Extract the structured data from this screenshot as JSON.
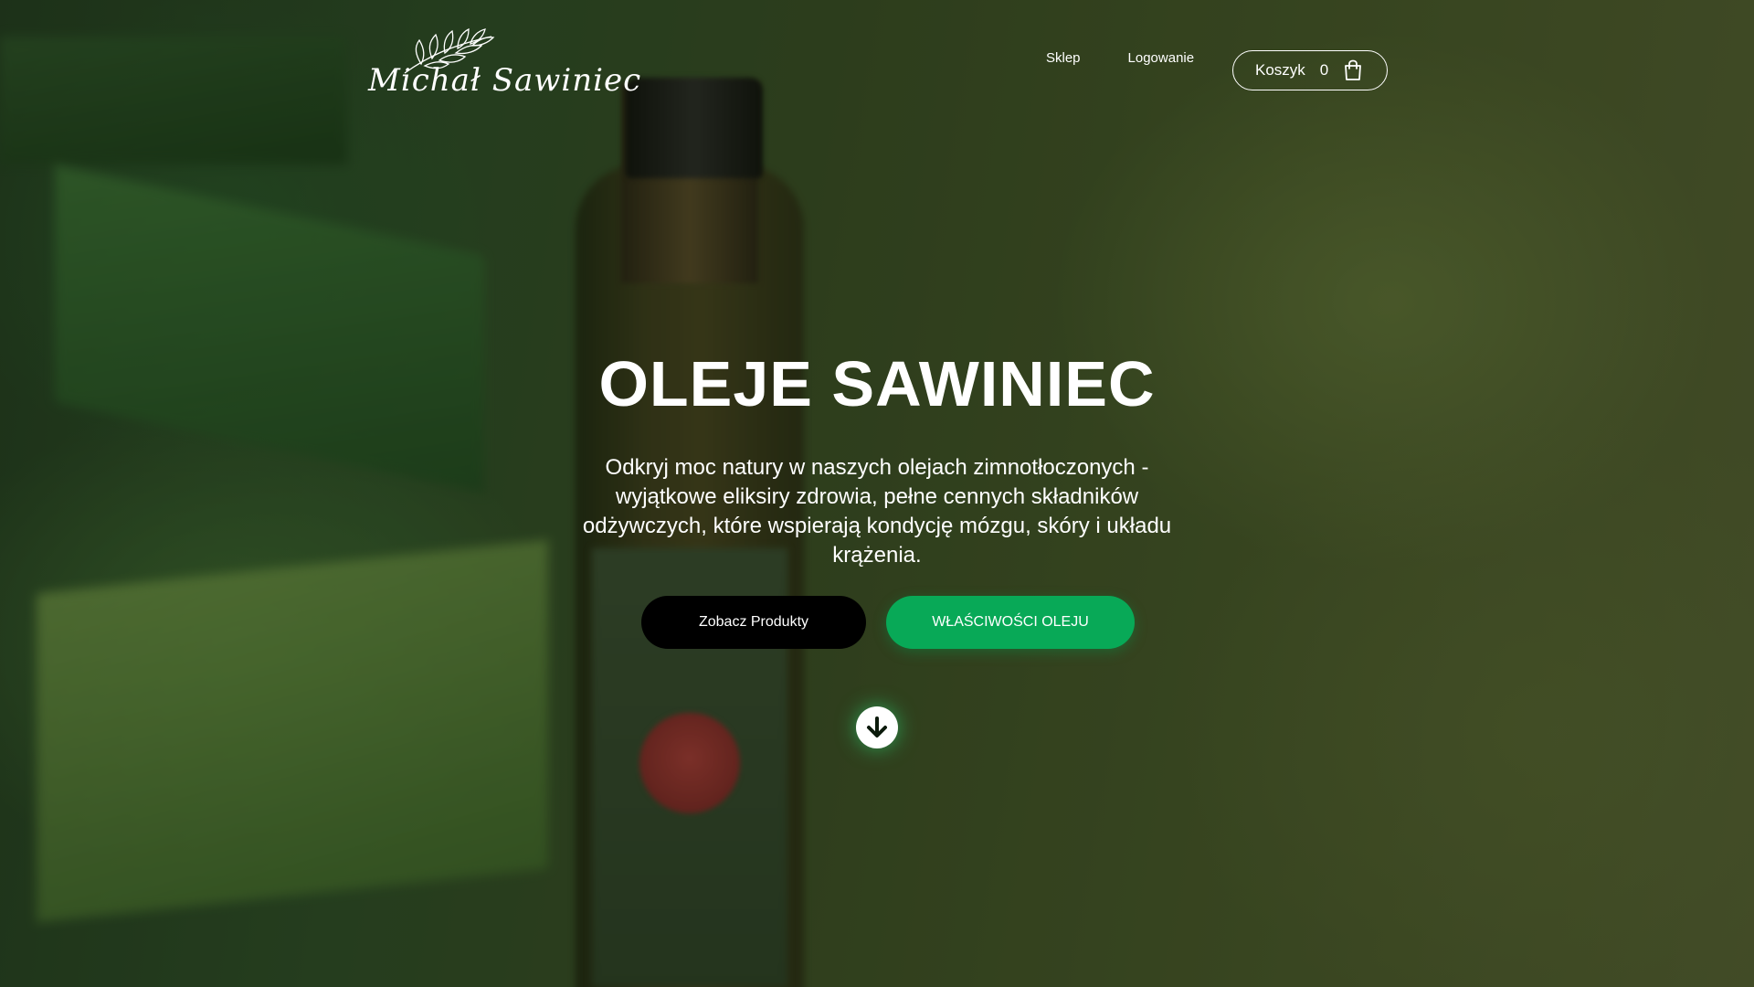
{
  "brand": {
    "logo_text": "Michał Sawiniec"
  },
  "nav": {
    "shop_label": "Sklep",
    "login_label": "Logowanie"
  },
  "cart": {
    "label": "Koszyk",
    "count": "0"
  },
  "hero": {
    "title": "OLEJE SAWINIEC",
    "description": "Odkryj moc natury w naszych olejach zimnotłoczonych - wyjątkowe eliksiry zdrowia, pełne cennych składników odżywczych, które wspierają kondycję mózgu, skóry i układu krążenia.",
    "primary_button": "Zobacz Produkty",
    "secondary_button": "WŁAŚCIWOŚCI OLEJU"
  },
  "icons": {
    "logo": "olive-branch-icon",
    "cart": "shopping-bag-icon",
    "scroll": "arrow-down-circle-icon"
  },
  "colors": {
    "accent_green": "#08a957",
    "dark_button": "#000000",
    "text": "#ffffff"
  }
}
